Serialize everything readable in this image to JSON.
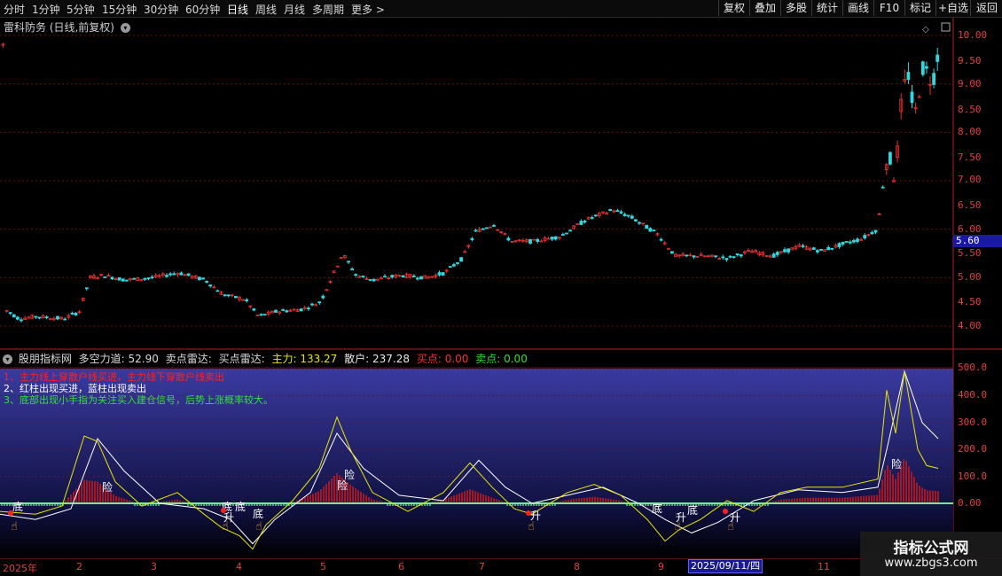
{
  "toolbar": {
    "periods": [
      {
        "label": "分时"
      },
      {
        "label": "1分钟"
      },
      {
        "label": "5分钟"
      },
      {
        "label": "15分钟"
      },
      {
        "label": "30分钟"
      },
      {
        "label": "60分钟"
      },
      {
        "label": "日线",
        "active": true
      },
      {
        "label": "周线"
      },
      {
        "label": "月线"
      },
      {
        "label": "多周期"
      },
      {
        "label": "更多 >"
      }
    ],
    "right_buttons": [
      "复权",
      "叠加",
      "多股",
      "统计",
      "画线",
      "F10",
      "标记",
      "+自选",
      "返回"
    ]
  },
  "main_chart": {
    "title": "雷科防务 (日线,前复权)",
    "price_axis": [
      "10.00",
      "9.50",
      "9.00",
      "8.50",
      "8.00",
      "7.50",
      "7.00",
      "6.50",
      "6.00",
      "5.50",
      "5.00",
      "4.50",
      "4.00"
    ],
    "current_price": "5.60"
  },
  "indicator": {
    "name": "股朋指标网",
    "fields": [
      {
        "text": "多空力道: 52.90",
        "color": "#d8d8d8"
      },
      {
        "text": "卖点雷达:",
        "color": "#d8d8d8"
      },
      {
        "text": "买点雷达:",
        "color": "#d8d8d8"
      },
      {
        "text": "主力: 133.27",
        "color": "#e8e800"
      },
      {
        "text": "散户: 237.28",
        "color": "#e8e8e8"
      },
      {
        "text": "买点: 0.00",
        "color": "#ff3030"
      },
      {
        "text": "卖点: 0.00",
        "color": "#30e030"
      }
    ],
    "notes": [
      {
        "text": "1、主力线上穿散户线买进，主力线下穿散户线卖出",
        "color": "#ff2020"
      },
      {
        "text": "2、红柱出现买进，蓝柱出现卖出",
        "color": "#ffffff"
      },
      {
        "text": "3、底部出现小手指为关注买入建仓信号，后势上涨概率较大。",
        "color": "#30e030"
      }
    ],
    "axis": [
      "500.0",
      "400.0",
      "300.0",
      "200.0",
      "100.0",
      "0.00"
    ],
    "markers": [
      {
        "type": "底",
        "text": "底"
      },
      {
        "type": "升",
        "text": "升"
      },
      {
        "type": "险",
        "text": "险"
      }
    ]
  },
  "x_axis": [
    "2025年",
    "2",
    "3",
    "4",
    "5",
    "6",
    "7",
    "8",
    "9",
    "11"
  ],
  "date_tag": "2025/09/11/四",
  "watermark": {
    "title": "指标公式网",
    "url": "www.zbgs3.com"
  },
  "colors": {
    "up": "#e83030",
    "down": "#30d8e0",
    "grid": "#7a1010",
    "bull": "#e8e800",
    "retail": "#ffffff"
  }
}
